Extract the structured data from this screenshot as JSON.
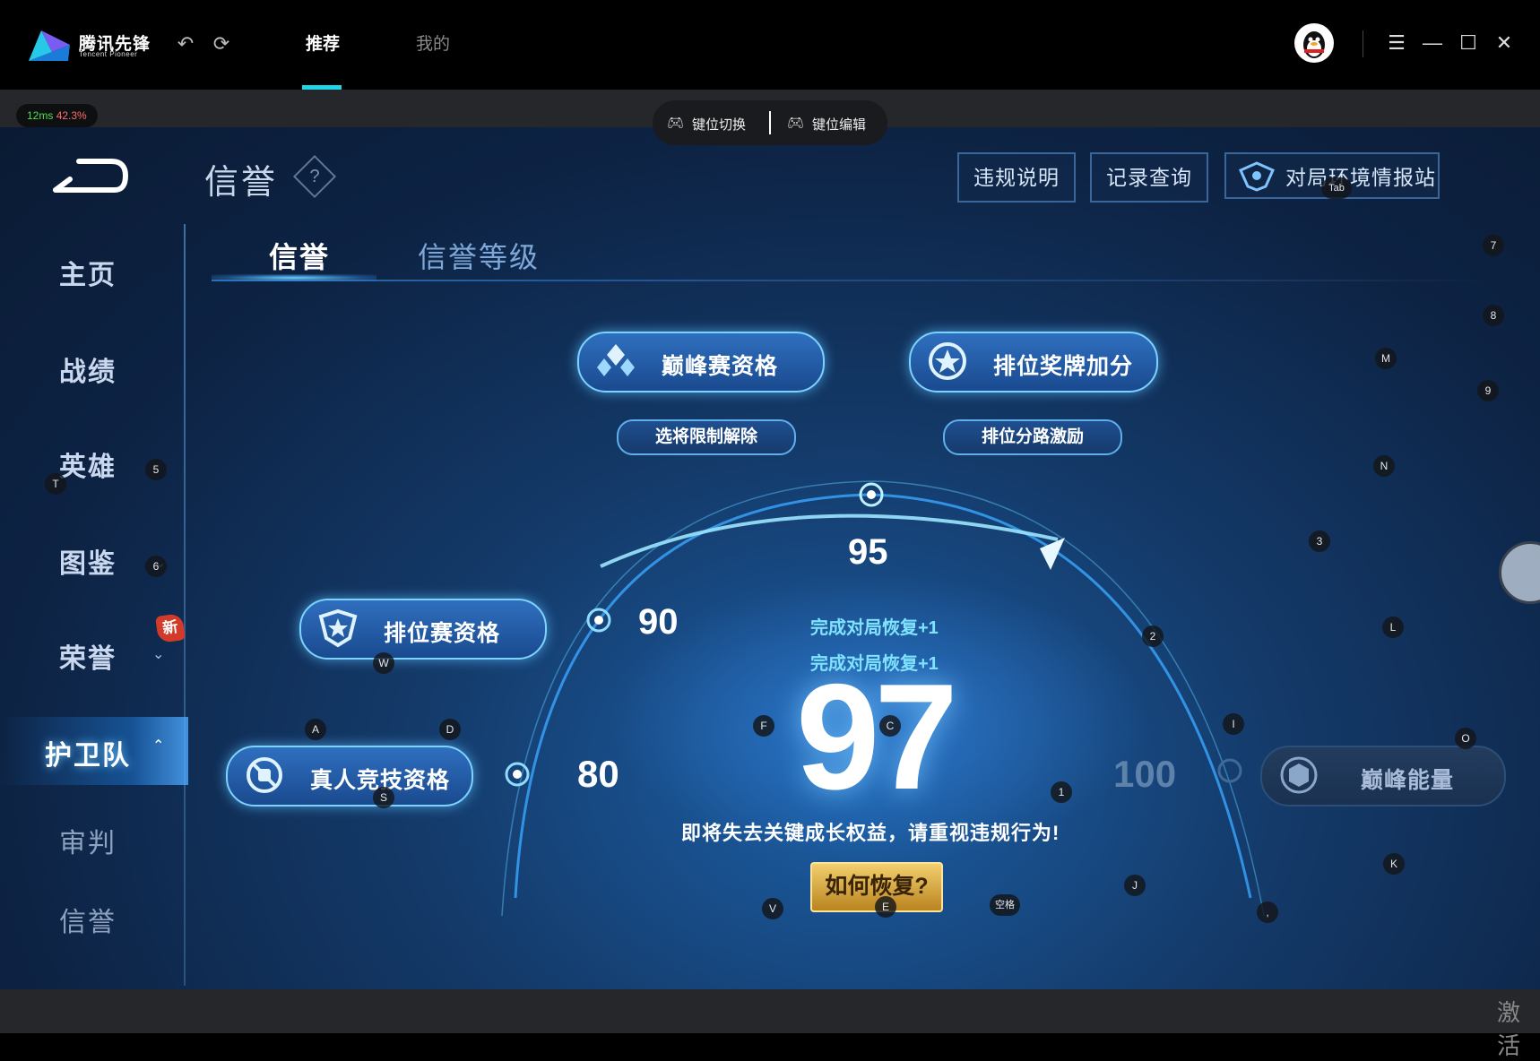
{
  "app": {
    "name": "腾讯先锋",
    "name_sub": "Tencent Pioneer",
    "nav_tabs": [
      {
        "label": "推荐",
        "active": true
      },
      {
        "label": "我的",
        "active": false
      }
    ],
    "accent": "#1fd6e8"
  },
  "stream": {
    "latency": "12ms",
    "loss": "42.3%",
    "keybar": {
      "switch_label": "键位切换",
      "edit_label": "键位编辑"
    },
    "watermark": "激活"
  },
  "page": {
    "title": "信誉",
    "header_buttons": {
      "violation": "违规说明",
      "records": "记录查询",
      "report": "对局环境情报站"
    },
    "tabs": [
      {
        "label": "信誉",
        "active": true
      },
      {
        "label": "信誉等级",
        "active": false
      }
    ]
  },
  "sidebar": {
    "items": [
      {
        "label": "主页"
      },
      {
        "label": "战绩"
      },
      {
        "label": "英雄"
      },
      {
        "label": "图鉴"
      },
      {
        "label": "荣誉",
        "badge": "新"
      },
      {
        "label": "护卫队",
        "active": true
      },
      {
        "label": "审判"
      },
      {
        "label": "信誉"
      }
    ]
  },
  "credit": {
    "score": "97",
    "thresholds": {
      "t80": "80",
      "t90": "90",
      "t95": "95",
      "t100": "100"
    },
    "recover_1": "完成对局恢复+1",
    "recover_2": "完成对局恢复+1",
    "warning": "即将失去关键成长权益，请重视违规行为!",
    "how_button": "如何恢复?",
    "tiers": {
      "peak": "巅峰赛资格",
      "peak_sub": "选将限制解除",
      "rank_medal": "排位奖牌加分",
      "rank_medal_sub": "排位分路激励",
      "ranked": "排位赛资格",
      "real_person": "真人竞技资格",
      "peak_energy": "巅峰能量"
    }
  },
  "keymap": {
    "tab": "Tab",
    "k7": "7",
    "k8": "8",
    "m": "M",
    "k9": "9",
    "n": "N",
    "k3": "3",
    "t": "T",
    "k5": "5",
    "k6": "6",
    "l": "L",
    "k2": "2",
    "w": "W",
    "a": "A",
    "d": "D",
    "f": "F",
    "c": "C",
    "i": "I",
    "o": "O",
    "s": "S",
    "k1": "1",
    "k": "K",
    "v": "V",
    "e": "E",
    "space": "空格",
    "j": "J",
    "comma": ","
  }
}
